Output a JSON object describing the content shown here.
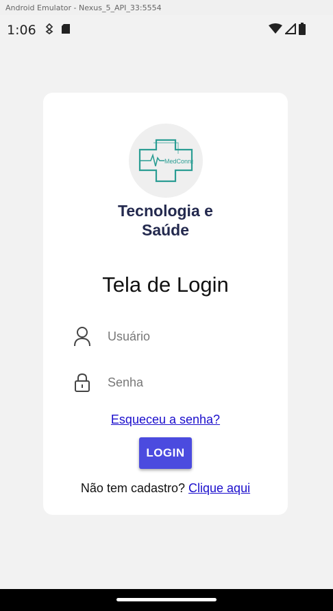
{
  "emulator": {
    "title": "Android Emulator - Nexus_5_API_33:5554"
  },
  "status_bar": {
    "time": "1:06",
    "left_icons": [
      "usb-debug-icon",
      "sd-card-icon"
    ],
    "right_icons": [
      "wifi-icon",
      "signal-icon",
      "battery-icon"
    ]
  },
  "logo": {
    "text": "MedConnect",
    "accent_color": "#2a9d93"
  },
  "brand": {
    "line1": "Tecnologia e",
    "line2": "Saúde",
    "color": "#23294e"
  },
  "login": {
    "title": "Tela de Login",
    "username_placeholder": "Usuário",
    "password_placeholder": "Senha",
    "forgot_link": "Esqueceu a senha?",
    "button_label": "LOGIN",
    "signup_prompt": "Não tem cadastro?",
    "signup_link": "Clique aqui",
    "button_color": "#4b4bdf",
    "link_color": "#1a0dcc"
  }
}
